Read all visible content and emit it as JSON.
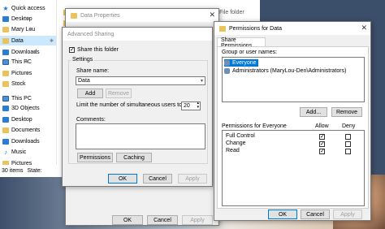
{
  "explorer": {
    "nav": [
      {
        "label": "Quick access",
        "icon": "star-icon",
        "kind": "star",
        "pinned": false
      },
      {
        "label": "Desktop",
        "icon": "desktop-icon",
        "kind": "blue",
        "pinned": true
      },
      {
        "label": "Mary Lou",
        "icon": "folder-icon",
        "kind": "folder",
        "pinned": true
      },
      {
        "label": "Data",
        "icon": "folder-icon",
        "kind": "folder",
        "pinned": true,
        "selected": true
      },
      {
        "label": "Downloads",
        "icon": "download-icon",
        "kind": "blue",
        "pinned": true
      },
      {
        "label": "This PC",
        "icon": "computer-icon",
        "kind": "pc",
        "pinned": true
      },
      {
        "label": "Pictures",
        "icon": "pictures-icon",
        "kind": "folder",
        "pinned": true
      },
      {
        "label": "Stock",
        "icon": "folder-icon",
        "kind": "folder",
        "pinned": false
      },
      {
        "label": "This PC",
        "icon": "computer-icon",
        "kind": "pc",
        "pinned": false
      },
      {
        "label": "3D Objects",
        "icon": "cube-icon",
        "kind": "blue",
        "pinned": false
      },
      {
        "label": "Desktop",
        "icon": "desktop-icon",
        "kind": "blue",
        "pinned": false
      },
      {
        "label": "Documents",
        "icon": "documents-icon",
        "kind": "folder",
        "pinned": false
      },
      {
        "label": "Downloads",
        "icon": "download-icon",
        "kind": "blue",
        "pinned": false
      },
      {
        "label": "Music",
        "icon": "music-icon",
        "kind": "music",
        "pinned": false
      },
      {
        "label": "Pictures",
        "icon": "pictures-icon",
        "kind": "folder",
        "pinned": false
      }
    ],
    "file_type": "File folder",
    "status_items": "30 items",
    "status_state": "State:"
  },
  "data_properties": {
    "title": "Data Properties",
    "ok": "OK",
    "cancel": "Cancel",
    "apply": "Apply"
  },
  "advanced_sharing": {
    "title": "Advanced Sharing",
    "share_checkbox": "Share this folder",
    "share_checked": true,
    "settings_label": "Settings",
    "share_name_label": "Share name:",
    "share_name_value": "Data",
    "add": "Add",
    "remove": "Remove",
    "limit_label": "Limit the number of simultaneous users to:",
    "limit_value": "20",
    "comments_label": "Comments:",
    "permissions": "Permissions",
    "caching": "Caching",
    "ok": "OK",
    "cancel": "Cancel",
    "apply": "Apply"
  },
  "permissions": {
    "title": "Permissions for Data",
    "tab": "Share Permissions",
    "group_label": "Group or user names:",
    "users": [
      "Everyone",
      "Administrators (MaryLou-Den\\Administrators)"
    ],
    "add": "Add...",
    "remove": "Remove",
    "perm_header": "Permissions for Everyone",
    "allow": "Allow",
    "deny": "Deny",
    "rows": [
      {
        "name": "Full Control",
        "allow": true,
        "deny": false
      },
      {
        "name": "Change",
        "allow": true,
        "deny": false
      },
      {
        "name": "Read",
        "allow": true,
        "deny": false
      }
    ],
    "ok": "OK",
    "cancel": "Cancel",
    "apply": "Apply"
  }
}
